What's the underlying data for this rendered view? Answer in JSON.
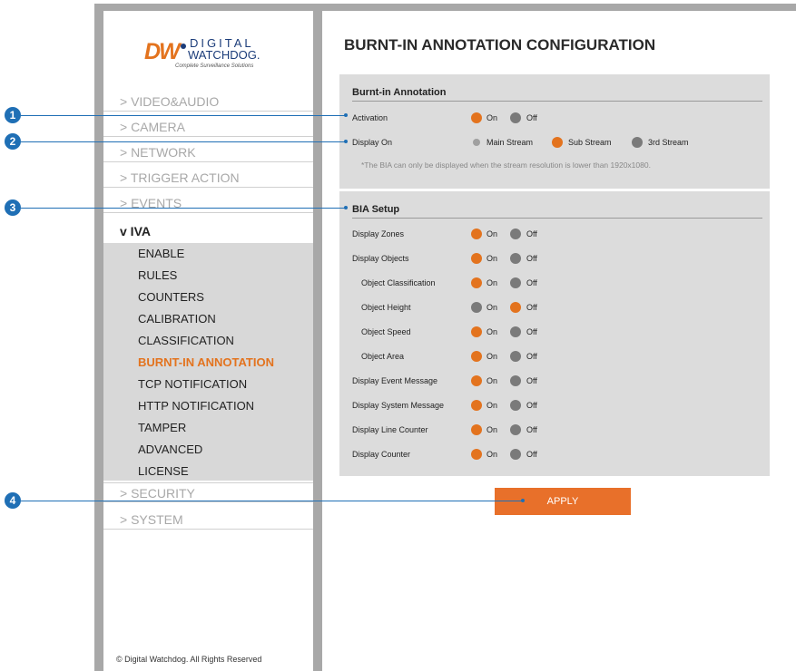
{
  "logo": {
    "mark": "DW",
    "line1": "DIGITAL",
    "line2": "WATCHDOG.",
    "tagline": "Complete Surveillance Solutions"
  },
  "sidebar": {
    "items": [
      {
        "label": "> VIDEO&AUDIO"
      },
      {
        "label": "> CAMERA"
      },
      {
        "label": "> NETWORK"
      },
      {
        "label": "> TRIGGER ACTION"
      },
      {
        "label": "> EVENTS"
      }
    ],
    "iva": {
      "label": "v IVA",
      "subitems": [
        {
          "label": "ENABLE"
        },
        {
          "label": "RULES"
        },
        {
          "label": "COUNTERS"
        },
        {
          "label": "CALIBRATION"
        },
        {
          "label": "CLASSIFICATION"
        },
        {
          "label": "BURNT-IN ANNOTATION",
          "active": true
        },
        {
          "label": "TCP NOTIFICATION"
        },
        {
          "label": "HTTP NOTIFICATION"
        },
        {
          "label": "TAMPER"
        },
        {
          "label": "ADVANCED"
        },
        {
          "label": "LICENSE"
        }
      ]
    },
    "after": [
      {
        "label": "> SECURITY"
      },
      {
        "label": "> SYSTEM"
      }
    ],
    "footer": "© Digital Watchdog. All Rights Reserved"
  },
  "main": {
    "title": "BURNT-IN ANNOTATION CONFIGURATION",
    "burnt_in": {
      "title": "Burnt-in Annotation",
      "activation": {
        "label": "Activation",
        "on": "On",
        "off": "Off",
        "value": "On"
      },
      "display_on": {
        "label": "Display On",
        "options": [
          "Main Stream",
          "Sub Stream",
          "3rd Stream"
        ],
        "value": "Sub Stream"
      },
      "note": "*The BIA can only be displayed when the stream resolution is lower than 1920x1080."
    },
    "bia_setup": {
      "title": "BIA Setup",
      "rows": [
        {
          "label": "Display Zones",
          "value": "On"
        },
        {
          "label": "Display Objects",
          "value": "On"
        },
        {
          "label": "Object Classification",
          "value": "On",
          "indent": true
        },
        {
          "label": "Object Height",
          "value": "Off",
          "indent": true
        },
        {
          "label": "Object Speed",
          "value": "On",
          "indent": true
        },
        {
          "label": "Object Area",
          "value": "On",
          "indent": true
        },
        {
          "label": "Display Event Message",
          "value": "On"
        },
        {
          "label": "Display System Message",
          "value": "On"
        },
        {
          "label": "Display Line Counter",
          "value": "On"
        },
        {
          "label": "Display Counter",
          "value": "On"
        }
      ],
      "on_label": "On",
      "off_label": "Off"
    },
    "apply_label": "APPLY"
  },
  "callouts": [
    "1",
    "2",
    "3",
    "4"
  ],
  "colors": {
    "accent": "#e3731e",
    "callout": "#1f6fb5",
    "panel": "#dcdcdc"
  }
}
